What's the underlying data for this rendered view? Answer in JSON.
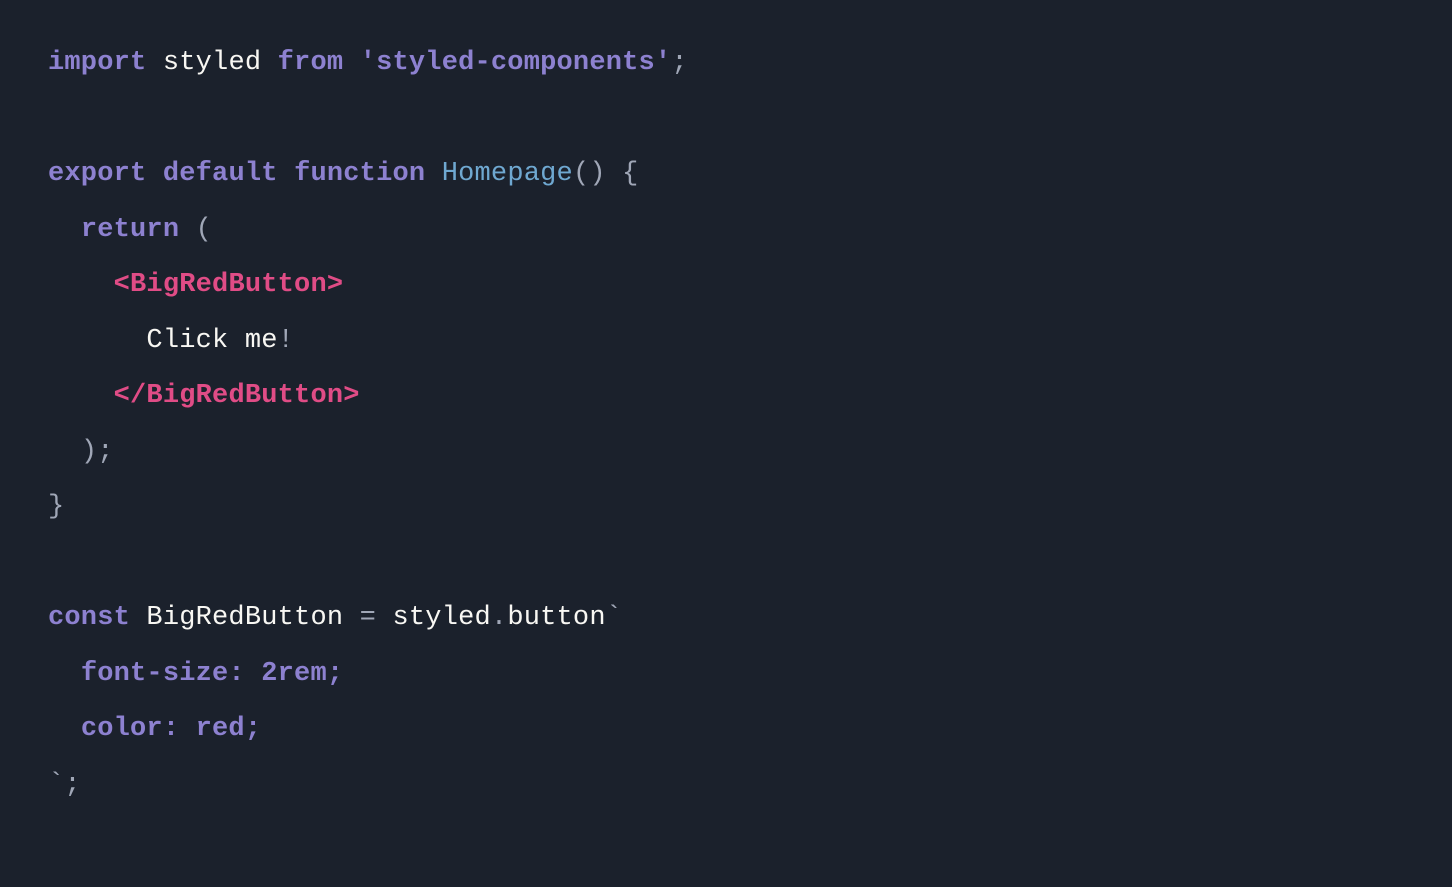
{
  "code": {
    "l1": {
      "import": "import",
      "styled": "styled",
      "from": "from",
      "pkg": "'styled-components'",
      "semi": ";"
    },
    "l2": "",
    "l3": {
      "export": "export",
      "default": "default",
      "function": "function",
      "fname": "Homepage",
      "parens": "()",
      "brace": "{"
    },
    "l4": {
      "indent": "  ",
      "return": "return",
      "paren": "("
    },
    "l5": {
      "indent": "    ",
      "tag": "<BigRedButton>"
    },
    "l6": {
      "indent": "      ",
      "text": "Click me",
      "excl": "!"
    },
    "l7": {
      "indent": "    ",
      "tag": "</BigRedButton>"
    },
    "l8": {
      "indent": "  ",
      "paren": ")",
      "semi": ";"
    },
    "l9": {
      "brace": "}"
    },
    "l10": "",
    "l11": {
      "const": "const",
      "name": "BigRedButton",
      "eq": " = ",
      "obj": "styled",
      "dot": ".",
      "method": "button",
      "bt": "`"
    },
    "l12": {
      "indent": "  ",
      "css": "font-size: 2rem;"
    },
    "l13": {
      "indent": "  ",
      "css": "color: red;"
    },
    "l14": {
      "bt": "`",
      "semi": ";"
    }
  }
}
